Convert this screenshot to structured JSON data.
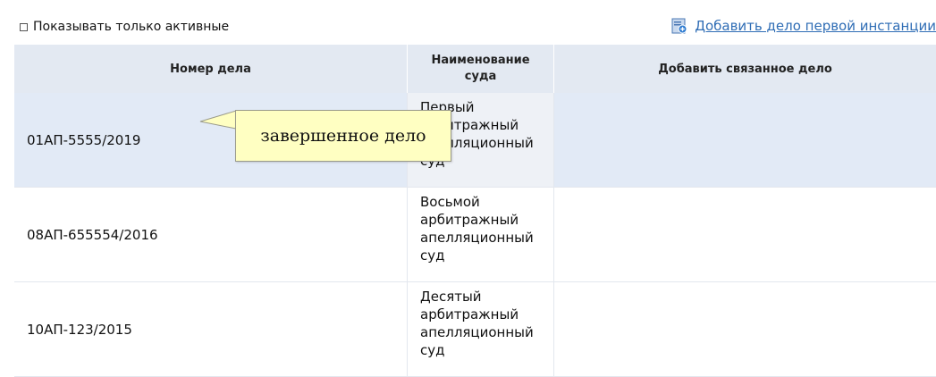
{
  "toolbar": {
    "filter_label": "Показывать только активные",
    "add_case_label": "Добавить дело первой инстанции"
  },
  "table": {
    "columns": [
      "Номер дела",
      "Наименование суда",
      "Добавить связанное дело"
    ],
    "rows": [
      {
        "case_number": "01АП-5555/2019",
        "court": "Первый\nарбитражный\nапелляционный\nсуд",
        "related": ""
      },
      {
        "case_number": "08АП-655554/2016",
        "court": "Восьмой\nарбитражный\nапелляционный\nсуд",
        "related": ""
      },
      {
        "case_number": "10АП-123/2015",
        "court": "Десятый\nарбитражный\nапелляционный\nсуд",
        "related": ""
      }
    ]
  },
  "tooltip": {
    "text": "завершенное дело"
  },
  "colors": {
    "link": "#2f6db5",
    "header_bg": "#e3e9f2",
    "selected_row_bg": "#e2eaf6",
    "tooltip_bg": "#ffffc2"
  },
  "icons": {
    "add_case": "add-document-icon",
    "filter": "checkbox-icon"
  }
}
